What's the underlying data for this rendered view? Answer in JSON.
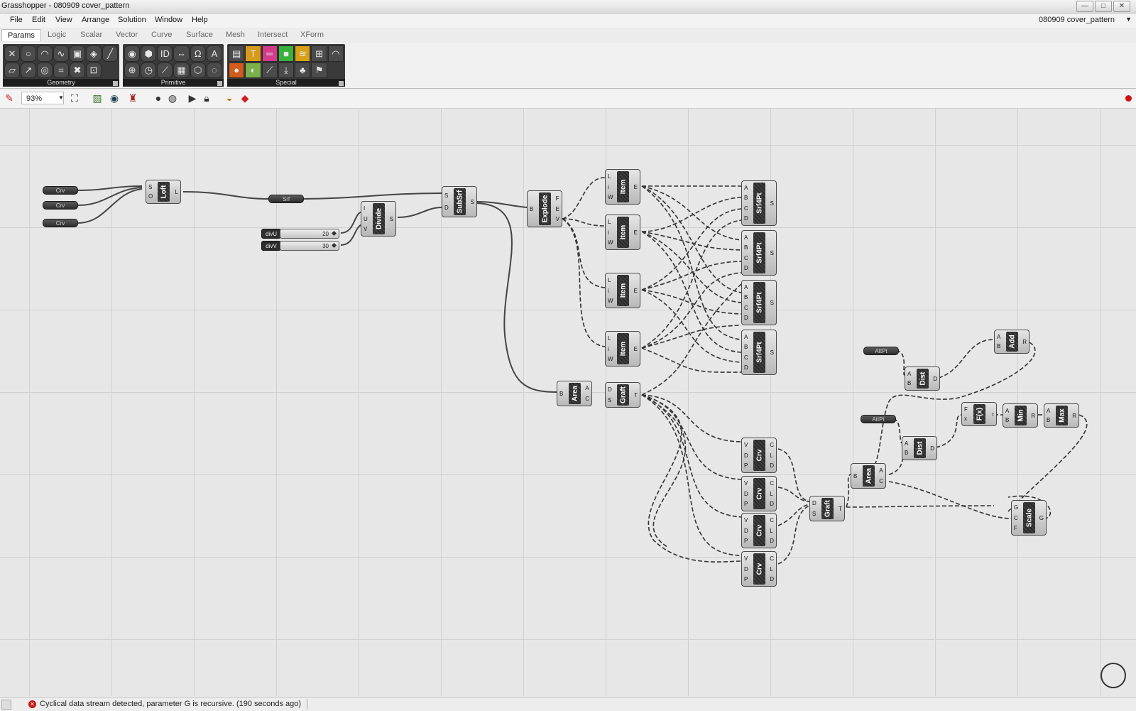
{
  "window": {
    "title": "Grasshopper - 080909 cover_pattern",
    "minimize": "—",
    "maximize": "□",
    "close": "✕"
  },
  "menu": [
    "File",
    "Edit",
    "View",
    "Arrange",
    "Solution",
    "Window",
    "Help"
  ],
  "document_name": "080909 cover_pattern",
  "tabs": [
    "Params",
    "Logic",
    "Scalar",
    "Vector",
    "Curve",
    "Surface",
    "Mesh",
    "Intersect",
    "XForm"
  ],
  "ribbon_panels": [
    {
      "label": "Geometry",
      "icons": [
        "point-icon",
        "circle-icon",
        "arc-icon",
        "curve-icon",
        "box-icon",
        "brep-icon",
        "line-icon",
        "plane-icon",
        "vector-icon",
        "surface-icon",
        "mesh-icon",
        "geometry-x-icon",
        "field-icon"
      ]
    },
    {
      "label": "Primitive",
      "icons": [
        "boolean-icon",
        "number-icon",
        "id-icon",
        "integer-icon",
        "string-icon",
        "text-icon",
        "shader-icon",
        "time-icon",
        "domain-icon",
        "matrix-icon",
        "complex-icon",
        "generic-icon"
      ]
    },
    {
      "label": "Special",
      "icons": [
        "graph-icon",
        "panel-icon",
        "slider-icon",
        "swatch-icon",
        "gradient-icon",
        "scribble-icon",
        "gauge-icon",
        "colorwheel-icon",
        "bezier-icon",
        "import-icon",
        "tree-icon",
        "brush-icon"
      ]
    }
  ],
  "canvas_toolbar": {
    "zoom": "93%"
  },
  "components": [
    {
      "name": "Loft",
      "inputs": [
        "S",
        "O"
      ],
      "outputs": [
        "L"
      ]
    },
    {
      "name": "Divide",
      "inputs": [
        "I",
        "U",
        "V"
      ],
      "outputs": [
        "S"
      ]
    },
    {
      "name": "SubSrf",
      "inputs": [
        "S",
        "D"
      ],
      "outputs": [
        "S"
      ]
    },
    {
      "name": "Explode",
      "inputs": [
        "B"
      ],
      "outputs": [
        "F",
        "E",
        "V"
      ]
    },
    {
      "name": "Item",
      "inputs": [
        "L",
        "i",
        "W"
      ],
      "outputs": [
        "E"
      ]
    },
    {
      "name": "Item",
      "inputs": [
        "L",
        "i",
        "W"
      ],
      "outputs": [
        "E"
      ]
    },
    {
      "name": "Item",
      "inputs": [
        "L",
        "i",
        "W"
      ],
      "outputs": [
        "E"
      ]
    },
    {
      "name": "Item",
      "inputs": [
        "L",
        "i",
        "W"
      ],
      "outputs": [
        "E"
      ]
    },
    {
      "name": "Area",
      "inputs": [
        "B"
      ],
      "outputs": [
        "A",
        "C"
      ]
    },
    {
      "name": "Graft",
      "inputs": [
        "D",
        "S"
      ],
      "outputs": [
        "T"
      ]
    },
    {
      "name": "Srf4Pt",
      "inputs": [
        "A",
        "B",
        "C",
        "D"
      ],
      "outputs": [
        "S"
      ]
    },
    {
      "name": "Srf4Pt",
      "inputs": [
        "A",
        "B",
        "C",
        "D"
      ],
      "outputs": [
        "S"
      ]
    },
    {
      "name": "Srf4Pt",
      "inputs": [
        "A",
        "B",
        "C",
        "D"
      ],
      "outputs": [
        "S"
      ]
    },
    {
      "name": "Srf4Pt",
      "inputs": [
        "A",
        "B",
        "C",
        "D"
      ],
      "outputs": [
        "S"
      ]
    },
    {
      "name": "Crv",
      "inputs": [
        "V",
        "D",
        "P"
      ],
      "outputs": [
        "C",
        "L",
        "D"
      ]
    },
    {
      "name": "Crv",
      "inputs": [
        "V",
        "D",
        "P"
      ],
      "outputs": [
        "C",
        "L",
        "D"
      ]
    },
    {
      "name": "Crv",
      "inputs": [
        "V",
        "D",
        "P"
      ],
      "outputs": [
        "C",
        "L",
        "D"
      ]
    },
    {
      "name": "Crv",
      "inputs": [
        "V",
        "D",
        "P"
      ],
      "outputs": [
        "C",
        "L",
        "D"
      ]
    },
    {
      "name": "Graft",
      "inputs": [
        "D",
        "S"
      ],
      "outputs": [
        "T"
      ]
    },
    {
      "name": "Area",
      "inputs": [
        "B"
      ],
      "outputs": [
        "A",
        "C"
      ]
    },
    {
      "name": "Dist",
      "inputs": [
        "A",
        "B"
      ],
      "outputs": [
        "D"
      ]
    },
    {
      "name": "Dist",
      "inputs": [
        "A",
        "B"
      ],
      "outputs": [
        "D"
      ]
    },
    {
      "name": "Add",
      "inputs": [
        "A",
        "B"
      ],
      "outputs": [
        "R"
      ]
    },
    {
      "name": "F(x)",
      "inputs": [
        "F",
        "x"
      ],
      "outputs": [
        "r"
      ]
    },
    {
      "name": "Min",
      "inputs": [
        "A",
        "B"
      ],
      "outputs": [
        "R"
      ]
    },
    {
      "name": "Max",
      "inputs": [
        "A",
        "B"
      ],
      "outputs": [
        "R"
      ]
    },
    {
      "name": "Scale",
      "inputs": [
        "G",
        "C",
        "F"
      ],
      "outputs": [
        "G"
      ]
    }
  ],
  "params": [
    "Crv",
    "Crv",
    "Crv",
    "Srf",
    "AttPt",
    "AttPt"
  ],
  "sliders": [
    {
      "name": "divU",
      "value": "20"
    },
    {
      "name": "divV",
      "value": "30"
    }
  ],
  "status": {
    "message": "Cyclical data stream detected, parameter G is recursive. (190 seconds ago)",
    "error_symbol": "✕"
  }
}
